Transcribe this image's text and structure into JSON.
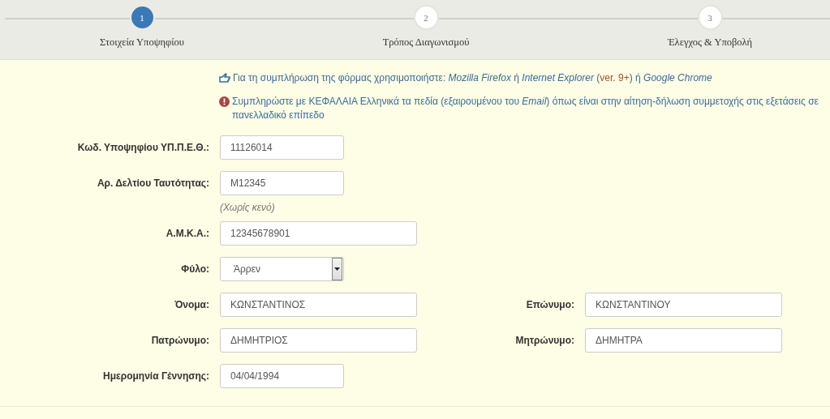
{
  "steps": [
    {
      "number": "1",
      "label": "Στοιχεία Υποψηφίου",
      "selected": true
    },
    {
      "number": "2",
      "label": "Τρόπος Διαγωνισμού",
      "selected": false
    },
    {
      "number": "3",
      "label": "Έλεγχος & Υποβολή",
      "selected": false
    }
  ],
  "notices": [
    {
      "kind": "info",
      "segments": [
        {
          "kind": "plain",
          "text": "Για τη συμπλήρωση της φόρμας χρησιμοποιήστε: "
        },
        {
          "kind": "italic",
          "text": "Mozilla Firefox"
        },
        {
          "kind": "plain",
          "text": " ή "
        },
        {
          "kind": "italic",
          "text": "Internet Explorer"
        },
        {
          "kind": "plain",
          "text": " ("
        },
        {
          "kind": "accent",
          "text": "ver. 9+"
        },
        {
          "kind": "plain",
          "text": ") ή "
        },
        {
          "kind": "italic",
          "text": "Google Chrome"
        }
      ]
    },
    {
      "kind": "warning",
      "segments": [
        {
          "kind": "plain",
          "text": "Συμπληρώστε με ΚΕΦΑΛΑΙΑ Ελληνικά τα πεδία (εξαιρουμένου του "
        },
        {
          "kind": "italic",
          "text": "Email"
        },
        {
          "kind": "plain",
          "text": ") όπως είναι στην αίτηση-δήλωση συμμετοχής στις εξετάσεις σε πανελλαδικό επίπεδο"
        }
      ]
    }
  ],
  "rows": [
    {
      "fields": [
        {
          "kind": "short",
          "label": "Κωδ. Υποψηφίου ΥΠ.Π.Ε.Θ.:",
          "value": "11126014"
        }
      ]
    },
    {
      "fields": [
        {
          "kind": "short",
          "label": "Αρ. Δελτίου Ταυτότητας:",
          "value": "M12345",
          "hint": "(Χωρίς κενό)"
        }
      ]
    },
    {
      "fields": [
        {
          "kind": "long",
          "label": "Α.Μ.Κ.Α.:",
          "value": "12345678901"
        }
      ]
    },
    {
      "fields": [
        {
          "kind": "select",
          "label": "Φύλο:",
          "value": "Άρρεν"
        }
      ]
    },
    {
      "fields": [
        {
          "kind": "long",
          "label": "Όνομα:",
          "value": "ΚΩΝΣΤΑΝΤΙΝΟΣ"
        },
        {
          "kind": "long",
          "label": "Επώνυμο:",
          "value": "ΚΩΝΣΤΑΝΤΙΝΟΥ"
        }
      ]
    },
    {
      "fields": [
        {
          "kind": "long",
          "label": "Πατρώνυμο:",
          "value": "ΔΗΜΗΤΡΙΟΣ"
        },
        {
          "kind": "long",
          "label": "Μητρώνυμο:",
          "value": "ΔΗΜΗΤΡΑ"
        }
      ]
    },
    {
      "fields": [
        {
          "kind": "short",
          "label": "Ημερομηνία Γέννησης:",
          "value": "04/04/1994"
        }
      ]
    }
  ]
}
